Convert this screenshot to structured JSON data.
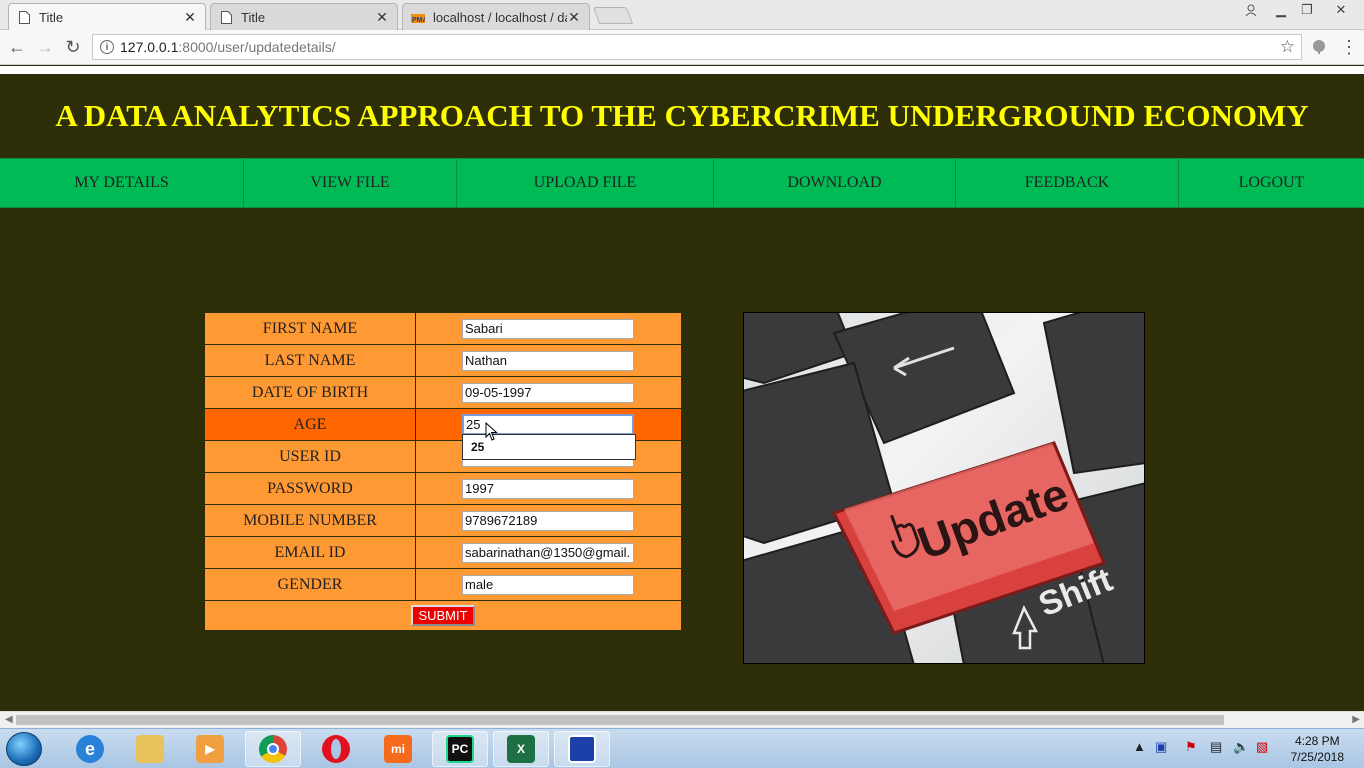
{
  "browser": {
    "tabs": [
      {
        "title": "Title",
        "active": true
      },
      {
        "title": "Title",
        "active": false
      },
      {
        "title": "localhost / localhost / da",
        "active": false
      }
    ],
    "url_host": "127.0.0.1",
    "url_path": ":8000/user/updatedetails/"
  },
  "page": {
    "title": "A DATA ANALYTICS APPROACH TO THE CYBERCRIME UNDERGROUND ECONOMY",
    "nav": [
      "MY DETAILS",
      "VIEW FILE",
      "UPLOAD FILE",
      "DOWNLOAD",
      "FEEDBACK",
      "LOGOUT"
    ]
  },
  "form": {
    "fields": [
      {
        "label": "FIRST NAME",
        "value": "Sabari"
      },
      {
        "label": "LAST NAME",
        "value": "Nathan"
      },
      {
        "label": "DATE OF BIRTH",
        "value": "09-05-1997"
      },
      {
        "label": "AGE",
        "value": "25"
      },
      {
        "label": "USER ID",
        "value": ""
      },
      {
        "label": "PASSWORD",
        "value": "1997"
      },
      {
        "label": "MOBILE NUMBER",
        "value": "9789672189"
      },
      {
        "label": "EMAIL ID",
        "value": "sabarinathan@1350@gmail."
      },
      {
        "label": "GENDER",
        "value": "male"
      }
    ],
    "autocomplete_suggestion": "25",
    "submit_label": "SUBMIT"
  },
  "image": {
    "key_text": "Update",
    "shift_text": "Shift"
  },
  "taskbar": {
    "time": "4:28 PM",
    "date": "7/25/2018",
    "apps": [
      "ie-icon",
      "explorer-icon",
      "media-player-icon",
      "chrome-icon",
      "opera-icon",
      "mi-icon",
      "pycharm-icon",
      "excel-icon",
      "snipping-tool-icon"
    ]
  },
  "colors": {
    "page_bg": "#2d2d08",
    "title_color": "#ffff00",
    "nav_bg": "#00bb55",
    "form_bg": "#ff9933",
    "highlight_row": "#ff6600",
    "submit_bg": "#ee0000"
  }
}
